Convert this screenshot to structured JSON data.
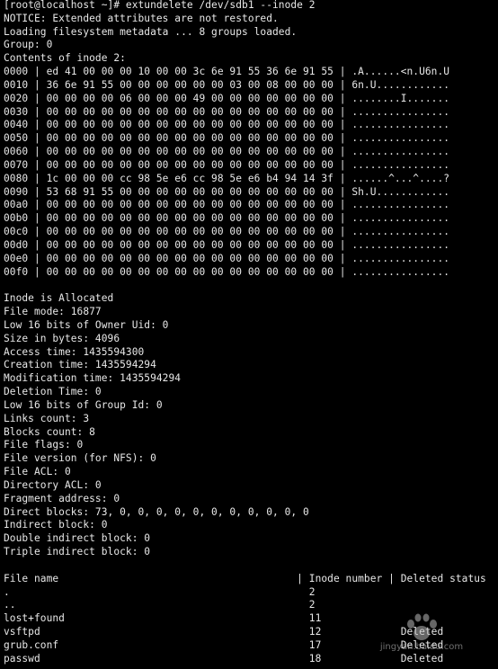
{
  "terminal": {
    "background": "#000000",
    "foreground": "#e8e8e8",
    "lines": [
      "[root@localhost ~]# extundelete /dev/sdb1 --inode 2",
      "NOTICE: Extended attributes are not restored.",
      "Loading filesystem metadata ... 8 groups loaded.",
      "Group: 0",
      "Contents of inode 2:",
      "0000 | ed 41 00 00 00 10 00 00 3c 6e 91 55 36 6e 91 55 | .A......<n.U6n.U",
      "0010 | 36 6e 91 55 00 00 00 00 00 00 03 00 08 00 00 00 | 6n.U............",
      "0020 | 00 00 00 00 06 00 00 00 49 00 00 00 00 00 00 00 | ........I.......",
      "0030 | 00 00 00 00 00 00 00 00 00 00 00 00 00 00 00 00 | ................",
      "0040 | 00 00 00 00 00 00 00 00 00 00 00 00 00 00 00 00 | ................",
      "0050 | 00 00 00 00 00 00 00 00 00 00 00 00 00 00 00 00 | ................",
      "0060 | 00 00 00 00 00 00 00 00 00 00 00 00 00 00 00 00 | ................",
      "0070 | 00 00 00 00 00 00 00 00 00 00 00 00 00 00 00 00 | ................",
      "0080 | 1c 00 00 00 cc 98 5e e6 cc 98 5e e6 b4 94 14 3f | ......^...^....?",
      "0090 | 53 68 91 55 00 00 00 00 00 00 00 00 00 00 00 00 | Sh.U............",
      "00a0 | 00 00 00 00 00 00 00 00 00 00 00 00 00 00 00 00 | ................",
      "00b0 | 00 00 00 00 00 00 00 00 00 00 00 00 00 00 00 00 | ................",
      "00c0 | 00 00 00 00 00 00 00 00 00 00 00 00 00 00 00 00 | ................",
      "00d0 | 00 00 00 00 00 00 00 00 00 00 00 00 00 00 00 00 | ................",
      "00e0 | 00 00 00 00 00 00 00 00 00 00 00 00 00 00 00 00 | ................",
      "00f0 | 00 00 00 00 00 00 00 00 00 00 00 00 00 00 00 00 | ................",
      "",
      "Inode is Allocated",
      "File mode: 16877",
      "Low 16 bits of Owner Uid: 0",
      "Size in bytes: 4096",
      "Access time: 1435594300",
      "Creation time: 1435594294",
      "Modification time: 1435594294",
      "Deletion Time: 0",
      "Low 16 bits of Group Id: 0",
      "Links count: 3",
      "Blocks count: 8",
      "File flags: 0",
      "File version (for NFS): 0",
      "File ACL: 0",
      "Directory ACL: 0",
      "Fragment address: 0",
      "Direct blocks: 73, 0, 0, 0, 0, 0, 0, 0, 0, 0, 0, 0",
      "Indirect block: 0",
      "Double indirect block: 0",
      "Triple indirect block: 0",
      "",
      "File name                                       | Inode number | Deleted status",
      ".                                                 2",
      "..                                                2",
      "lost+found                                        11",
      "vsftpd                                            12             Deleted",
      "grub.conf                                         17             Deleted",
      "passwd                                            18             Deleted"
    ]
  },
  "watermark": {
    "text": "jingyan.baidu.com"
  }
}
